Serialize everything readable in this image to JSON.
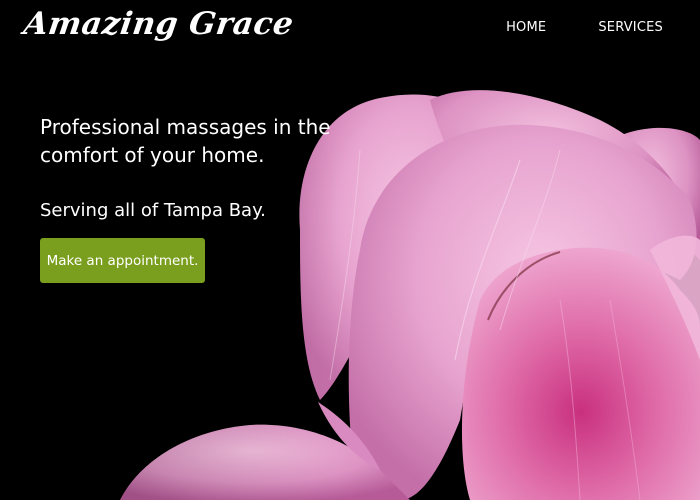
{
  "brand": {
    "name": "Amazing Grace"
  },
  "nav": {
    "items": [
      {
        "label": "HOME"
      },
      {
        "label": "SERVICES"
      }
    ]
  },
  "hero": {
    "headline": "Professional massages in the comfort of your home.",
    "tagline": "Serving all of Tampa Bay.",
    "cta_label": "Make an appointment.",
    "cta_color": "#7a9e1e",
    "background_color": "#000000",
    "image": "pink-peony-flower"
  }
}
